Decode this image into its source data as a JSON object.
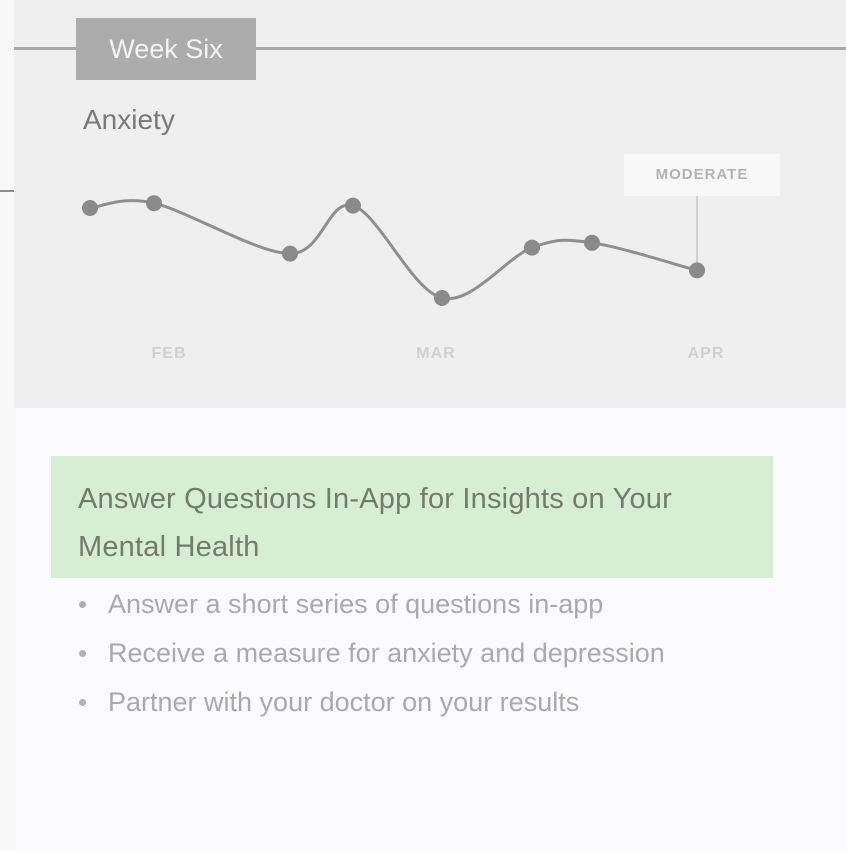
{
  "timeline": {
    "week_label": "Week Six"
  },
  "chart_data": {
    "type": "line",
    "title": "Anxiety",
    "x_tick_labels": [
      "FEB",
      "MAR",
      "APR"
    ],
    "series": [
      {
        "values": [
          0.8,
          0.84,
          0.42,
          0.82,
          0.05,
          0.47,
          0.51,
          0.28
        ]
      }
    ],
    "annotation": "MODERATE",
    "line_color": "#8f8f8f",
    "point_color": "#8a8a8a",
    "grid": false
  },
  "content": {
    "headline": "Answer Questions In-App for Insights on Your Mental Health",
    "bullets": [
      "Answer a short series of questions in-app",
      "Receive a measure for anxiety and depression",
      "Partner with your doctor on your results"
    ]
  },
  "colors": {
    "highlight": "#d7eed5",
    "tab": "#acacac",
    "panel": "#efefef"
  }
}
